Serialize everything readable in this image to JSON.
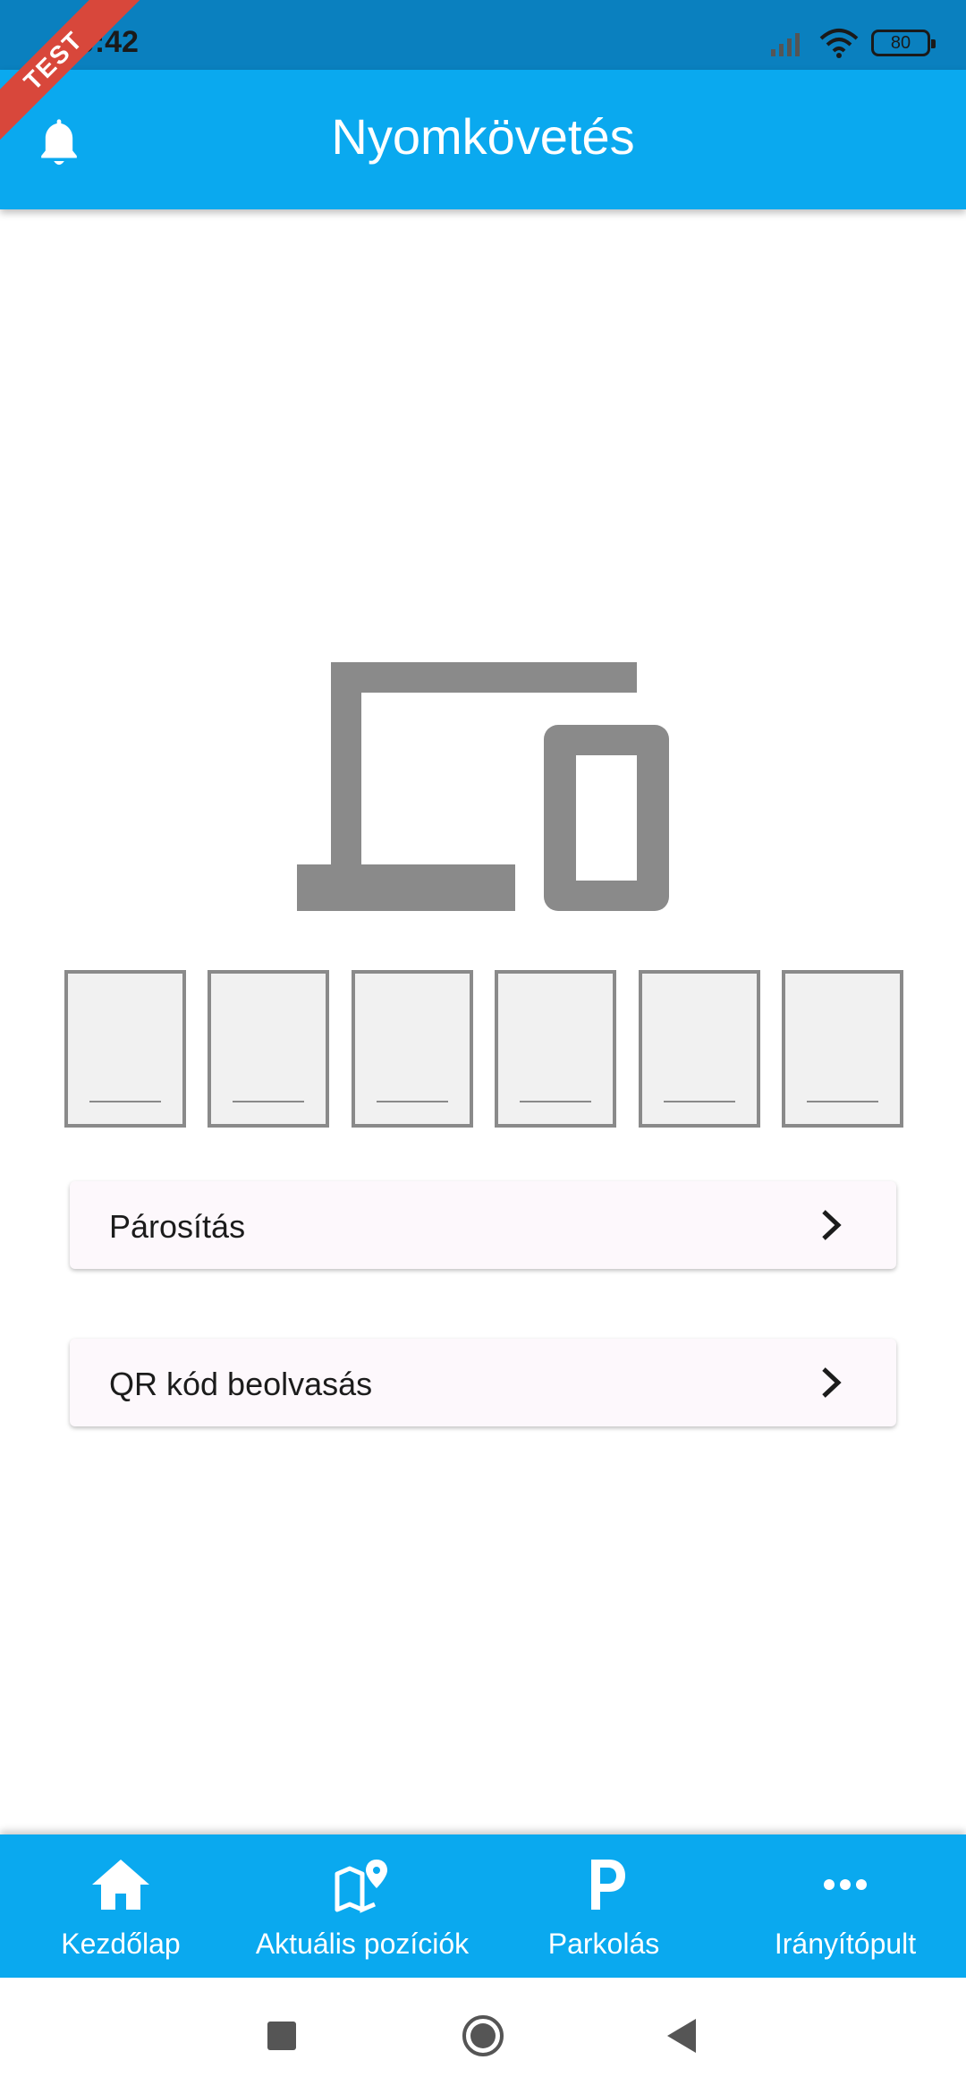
{
  "status_bar": {
    "time": "10:42",
    "battery": "80"
  },
  "debug_banner": "TEST",
  "app_bar": {
    "title": "Nyomkövetés",
    "icon": "bell-icon"
  },
  "pairing": {
    "illustration_icon": "devices-icon",
    "code_digits": [
      "",
      "",
      "",
      "",
      "",
      ""
    ]
  },
  "actions": [
    {
      "label": "Párosítás",
      "icon": "chevron-right-icon"
    },
    {
      "label": "QR kód beolvasás",
      "icon": "chevron-right-icon"
    }
  ],
  "bottom_nav": [
    {
      "label": "Kezdőlap",
      "icon": "home-icon"
    },
    {
      "label": "Aktuális pozíciók",
      "icon": "map-pin-icon"
    },
    {
      "label": "Parkolás",
      "icon": "parking-icon"
    },
    {
      "label": "Irányítópult",
      "icon": "more-dots-icon"
    }
  ],
  "colors": {
    "primary": "#0aa9ef",
    "status_bar": "#0a80bf",
    "icon_gray": "#8a8a8a",
    "ribbon": "#d8473b"
  }
}
